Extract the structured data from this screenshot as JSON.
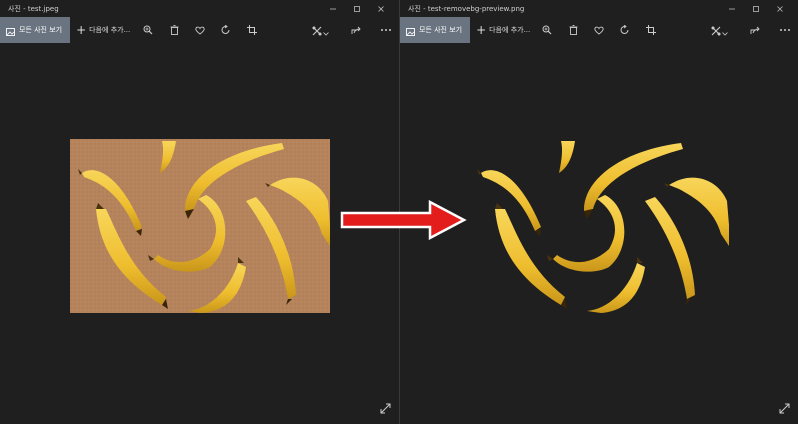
{
  "windows": [
    {
      "title": "사진 - test.jpeg",
      "all_photos_label": "모든 사진 보기",
      "add_to_label": "다음에 추가...",
      "image": "original-banana-photo"
    },
    {
      "title": "사진 - test-removebg-preview.png",
      "all_photos_label": "모든 사진 보기",
      "add_to_label": "다음에 추가...",
      "image": "background-removed-banana-photo"
    }
  ],
  "colors": {
    "window_bg": "#1f1f1f",
    "selected_button_bg": "#6a7480",
    "photo_bg": "#b5845c",
    "banana_yellow": "#f2c43a",
    "arrow_red": "#e31c1c"
  },
  "icons": [
    "photo-icon",
    "add-icon",
    "zoom-icon",
    "delete-icon",
    "favorite-icon",
    "rotate-icon",
    "crop-icon",
    "edit-icon",
    "chevron-down-icon",
    "share-icon",
    "more-icon",
    "expand-icon",
    "minimize-icon",
    "maximize-icon",
    "close-icon"
  ]
}
